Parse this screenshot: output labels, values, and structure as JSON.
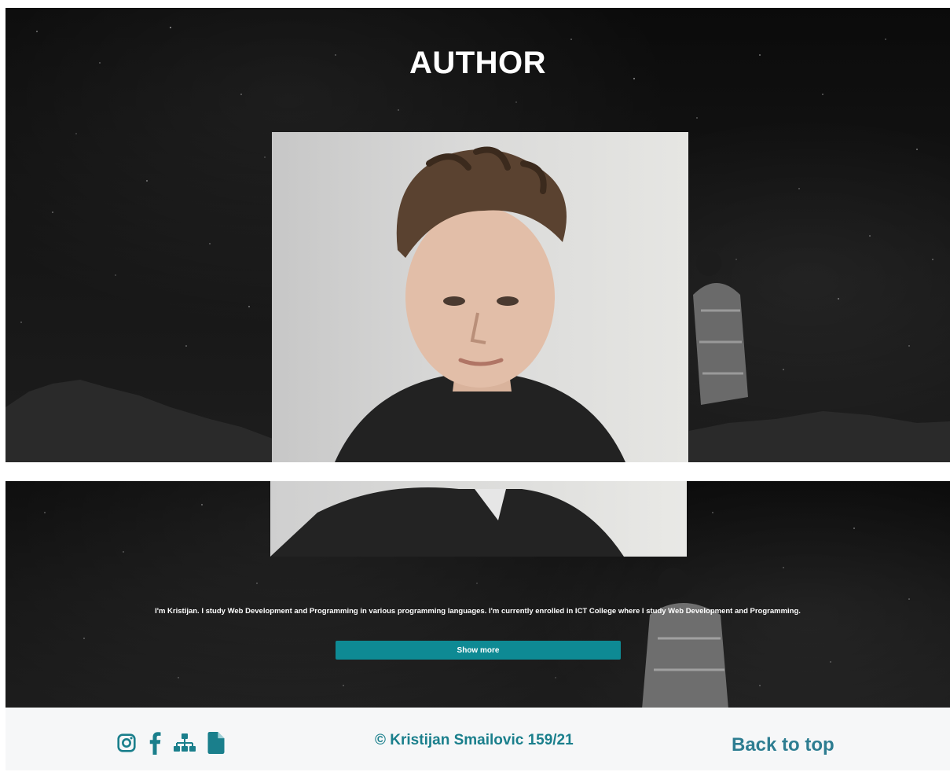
{
  "author_section": {
    "heading": "AUTHOR",
    "bio": "I'm Kristijan. I study Web Development and Programming in various programming languages. I'm currently enrolled in ICT College where I study Web Development and Programming.",
    "show_more_label": "Show more"
  },
  "footer": {
    "copyright_symbol": "©",
    "copyright_text": "Kristijan Smailovic 159/21",
    "back_to_top_label": "Back to top",
    "social_icons": [
      "instagram-icon",
      "facebook-icon",
      "sitemap-icon",
      "document-icon"
    ]
  },
  "colors": {
    "accent": "#0e8a94",
    "footer_text": "#1a7f8c",
    "footer_bg": "#f6f7f8",
    "hero_bg": "#111111"
  }
}
